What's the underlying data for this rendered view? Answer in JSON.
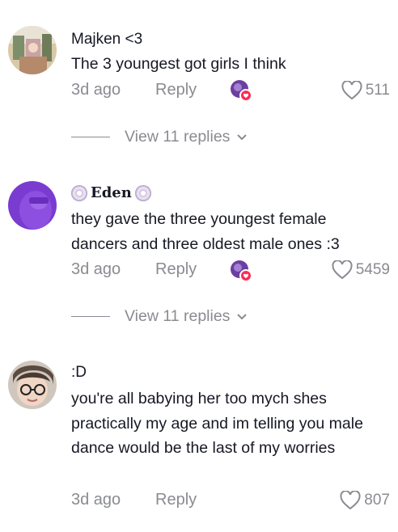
{
  "comments": [
    {
      "username": "Majken <3",
      "text": "The 3 youngest got girls I think",
      "time": "3d ago",
      "reply_label": "Reply",
      "likes": "511",
      "view_replies": "View 11 replies"
    },
    {
      "username": "Eden",
      "text": "they gave the three youngest female dancers and three oldest male ones :3",
      "time": "3d ago",
      "reply_label": "Reply",
      "likes": "5459",
      "view_replies": "View 11 replies"
    },
    {
      "username": ":D",
      "text": "you're all babying her too mych shes practically my age and im telling you male dance would be the last of my worries",
      "time": "3d ago",
      "reply_label": "Reply",
      "likes": "807"
    }
  ],
  "colors": {
    "text": "#161823",
    "muted": "#8a8b91",
    "liker_badge": "#fe2c55",
    "eden_avatar": "#7a3bd1"
  },
  "icons": {
    "like": "heart-outline-icon",
    "expand": "chevron-down-icon",
    "creator_liked": "creator-liked-avatar-icon",
    "username_decoration": "disc-icon"
  }
}
